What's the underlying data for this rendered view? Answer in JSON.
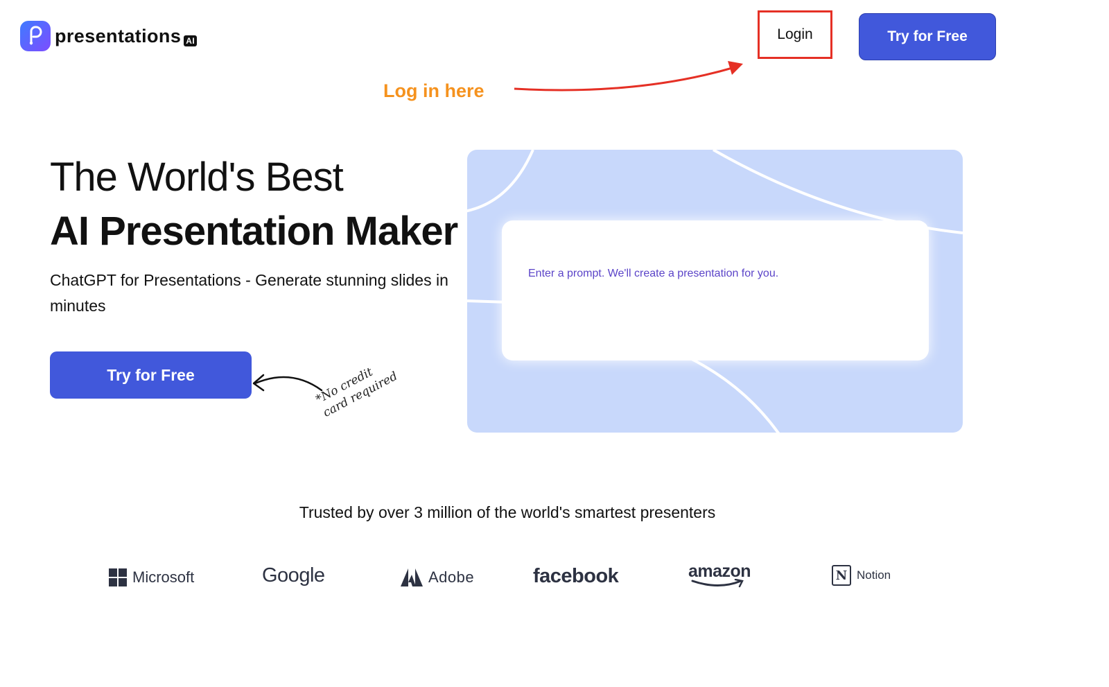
{
  "header": {
    "logo_text": "presentations",
    "logo_badge": "AI",
    "login_label": "Login",
    "try_label": "Try for Free"
  },
  "annotation": {
    "text": "Log in here"
  },
  "hero": {
    "title_line1": "The World's Best",
    "title_line2": "AI Presentation Maker",
    "subtitle": "ChatGPT for Presentations - Generate stunning slides in minutes",
    "cta_label": "Try for Free",
    "no_credit_note": "*No credit\ncard required"
  },
  "prompt": {
    "placeholder": "Enter a prompt. We'll create a presentation for you."
  },
  "trusted": {
    "text": "Trusted by over 3 million of the world's smartest presenters",
    "brands": [
      "Microsoft",
      "Google",
      "Adobe",
      "facebook",
      "amazon",
      "Notion"
    ]
  },
  "colors": {
    "primary": "#4158db",
    "annotation_orange": "#f5921e",
    "annotation_red": "#e53025",
    "panel_blue": "#c8d8fb"
  }
}
